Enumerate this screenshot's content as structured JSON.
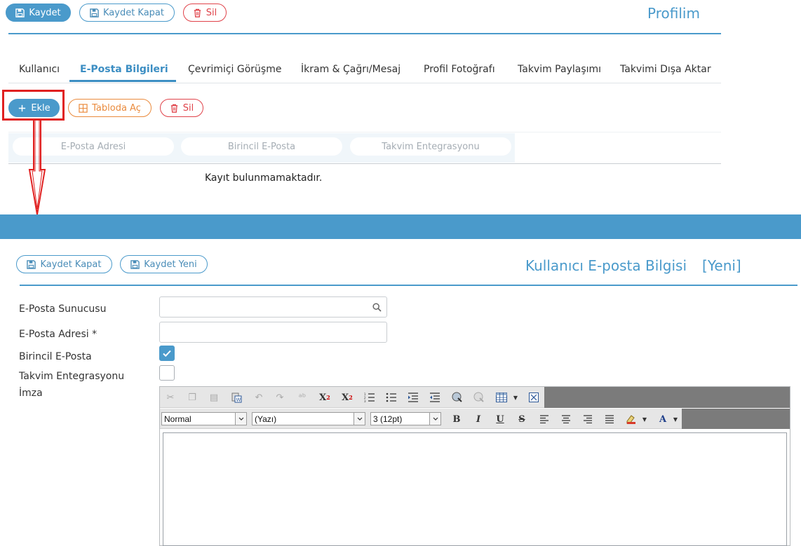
{
  "top": {
    "toolbar": {
      "save": "Kaydet",
      "save_close": "Kaydet Kapat",
      "delete": "Sil"
    },
    "title": "Profilim",
    "tabs": [
      "Kullanıcı",
      "E-Posta Bilgileri",
      "Çevrimiçi Görüşme",
      "İkram & Çağrı/Mesaj",
      "Profil Fotoğrafı",
      "Takvim Paylaşımı",
      "Takvimi Dışa Aktar"
    ],
    "active_tab": "E-Posta Bilgileri",
    "list_toolbar": {
      "add": "Ekle",
      "open_table": "Tabloda Aç",
      "delete": "Sil"
    },
    "columns": [
      "E-Posta Adresi",
      "Birincil E-Posta",
      "Takvim Entegrasyonu"
    ],
    "empty_message": "Kayıt bulunmamaktadır."
  },
  "dialog": {
    "toolbar": {
      "save_close": "Kaydet Kapat",
      "save_new": "Kaydet Yeni"
    },
    "title": "Kullanıcı E-posta Bilgisi",
    "mode": "[Yeni]",
    "fields": {
      "server_label": "E-Posta Sunucusu",
      "server_value": "",
      "address_label": "E-Posta Adresi *",
      "address_value": "",
      "primary_label": "Birincil E-Posta",
      "primary_checked": true,
      "calendar_label": "Takvim Entegrasyonu",
      "calendar_checked": false,
      "signature_label": "İmza"
    },
    "editor": {
      "format": "Normal",
      "font": "(Yazı)",
      "size": "3 (12pt)",
      "bold": "B",
      "italic": "I",
      "underline": "U",
      "strike": "S",
      "font_color": "A"
    }
  },
  "colors": {
    "accent": "#4a9acb",
    "danger": "#e0434a",
    "warning": "#ea8a3c",
    "highlight": "#e02020"
  }
}
